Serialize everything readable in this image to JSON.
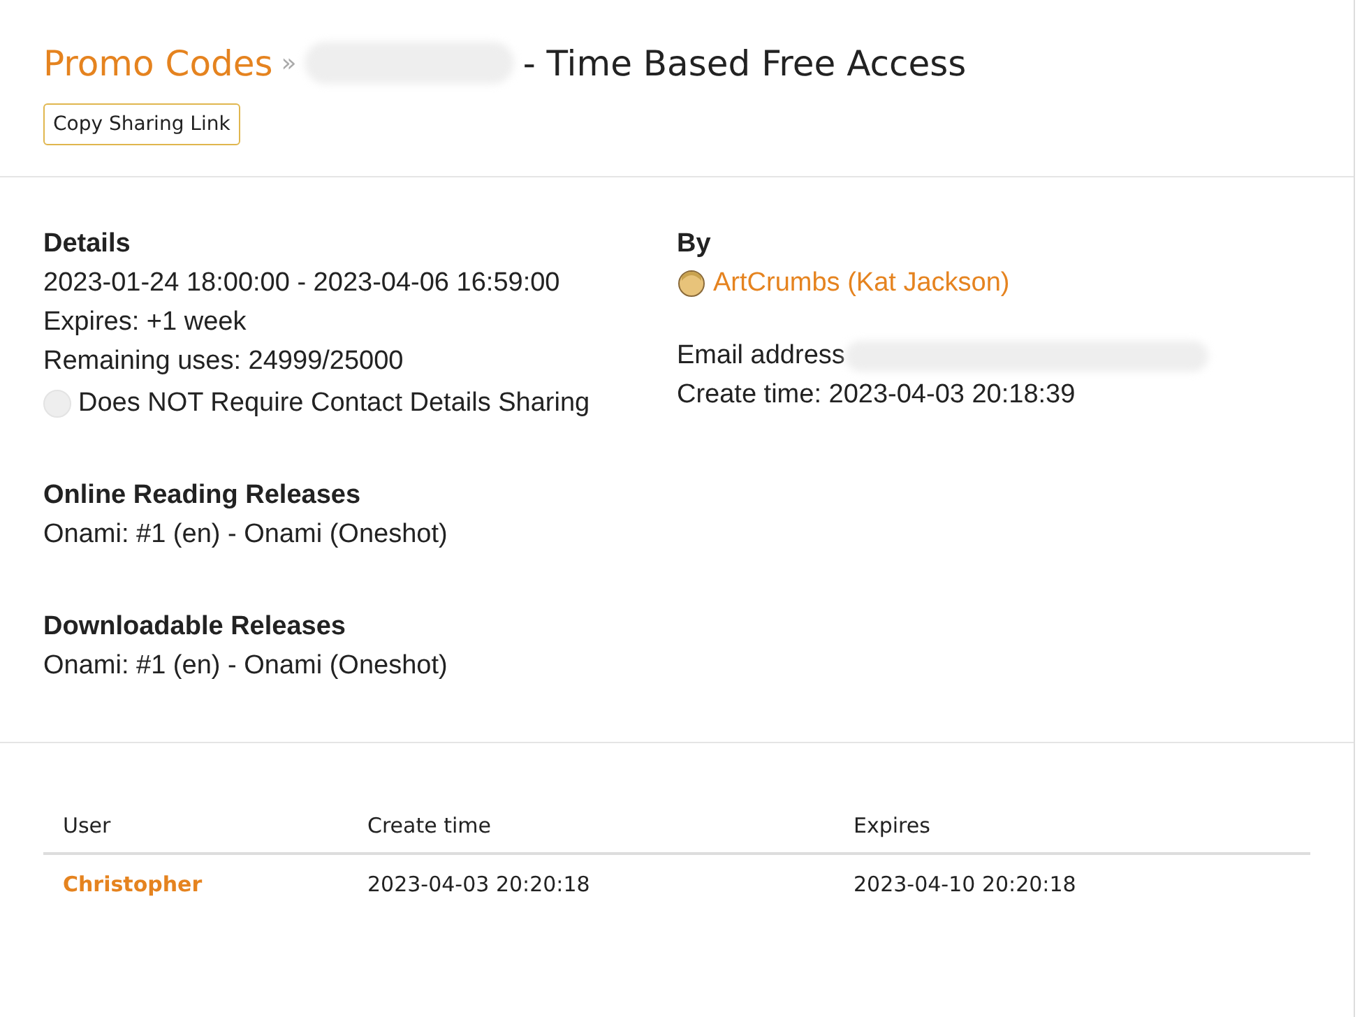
{
  "breadcrumb": {
    "parent": "Promo Codes",
    "separator": "»",
    "title": "- Time Based Free Access"
  },
  "copy_button": "Copy Sharing Link",
  "details": {
    "heading": "Details",
    "lines": [
      "2023-01-24 18:00:00 - 2023-04-06 16:59:00",
      "Expires: +1 week",
      "Remaining uses: 24999/25000"
    ],
    "contact_option": {
      "label": "Does NOT Require Contact Details Sharing",
      "checked": false
    }
  },
  "by": {
    "heading": "By",
    "user": "ArtCrumbs (Kat Jackson)",
    "email_label": "Email address",
    "create_time": "Create time: 2023-04-03 20:18:39"
  },
  "sections": [
    {
      "heading": "Online Reading Releases",
      "items": [
        "Onami: #1 (en) - Onami (Oneshot)"
      ]
    },
    {
      "heading": "Downloadable Releases",
      "items": [
        "Onami: #1 (en) - Onami (Oneshot)"
      ]
    }
  ],
  "table": {
    "columns": [
      "User",
      "Create time",
      "Expires"
    ],
    "rows": [
      [
        "Christopher",
        "2023-04-03 20:20:18",
        "2023-04-10 20:20:18"
      ]
    ]
  }
}
